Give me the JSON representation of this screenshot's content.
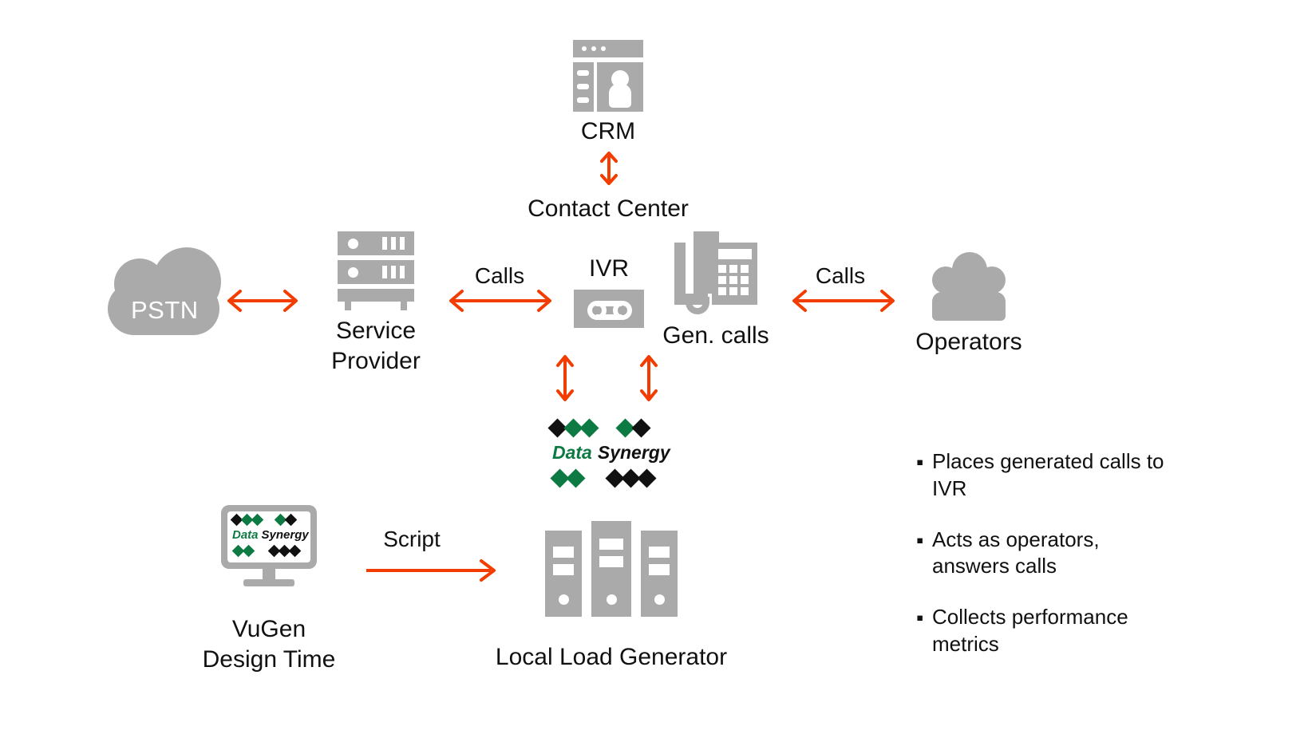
{
  "diagram": {
    "title": "Contact Center load testing topology",
    "colors": {
      "icon_gray": "#aaaaaa",
      "arrow_red": "#f23c00",
      "logo_green": "#0e7a43",
      "text_black": "#111111",
      "background": "#ffffff"
    }
  },
  "nodes": {
    "pstn": {
      "label": "PSTN",
      "icon": "cloud-icon"
    },
    "service_provider": {
      "label": "Service\nProvider",
      "icon": "server-rack-icon"
    },
    "crm": {
      "label": "CRM",
      "icon": "crm-window-icon"
    },
    "contact_center": {
      "label": "Contact Center"
    },
    "ivr": {
      "label": "IVR",
      "icon": "cassette-tape-icon"
    },
    "gen_calls": {
      "label": "Gen. calls",
      "icon": "desk-phone-icon"
    },
    "operators": {
      "label": "Operators",
      "icon": "people-group-icon"
    },
    "vugen": {
      "label": "VuGen\nDesign Time",
      "icon": "monitor-icon"
    },
    "load_generator": {
      "label": "Local Load Generator",
      "icon": "server-towers-icon"
    }
  },
  "logo": {
    "word_first": "Data",
    "word_second": "Synergy",
    "top_row": [
      "black",
      "green",
      "green",
      "gap",
      "green",
      "black"
    ],
    "bottom_row": [
      "green",
      "green",
      "gap",
      "black",
      "black",
      "black"
    ]
  },
  "edges": {
    "pstn_sp": {
      "label": "",
      "kind": "double-arrow-horizontal"
    },
    "sp_ivr": {
      "label": "Calls",
      "kind": "double-arrow-horizontal"
    },
    "phone_operators": {
      "label": "Calls",
      "kind": "double-arrow-horizontal"
    },
    "crm_cc": {
      "label": "",
      "kind": "double-arrow-vertical"
    },
    "ivr_lg": {
      "label": "",
      "kind": "double-arrow-vertical"
    },
    "phone_lg": {
      "label": "",
      "kind": "double-arrow-vertical"
    },
    "vugen_lg": {
      "label": "Script",
      "kind": "single-arrow-right"
    }
  },
  "notes": {
    "bullet_mark": "▪",
    "items": [
      "Places generated calls to IVR",
      "Acts as operators, answers calls",
      "Collects performance metrics"
    ]
  }
}
